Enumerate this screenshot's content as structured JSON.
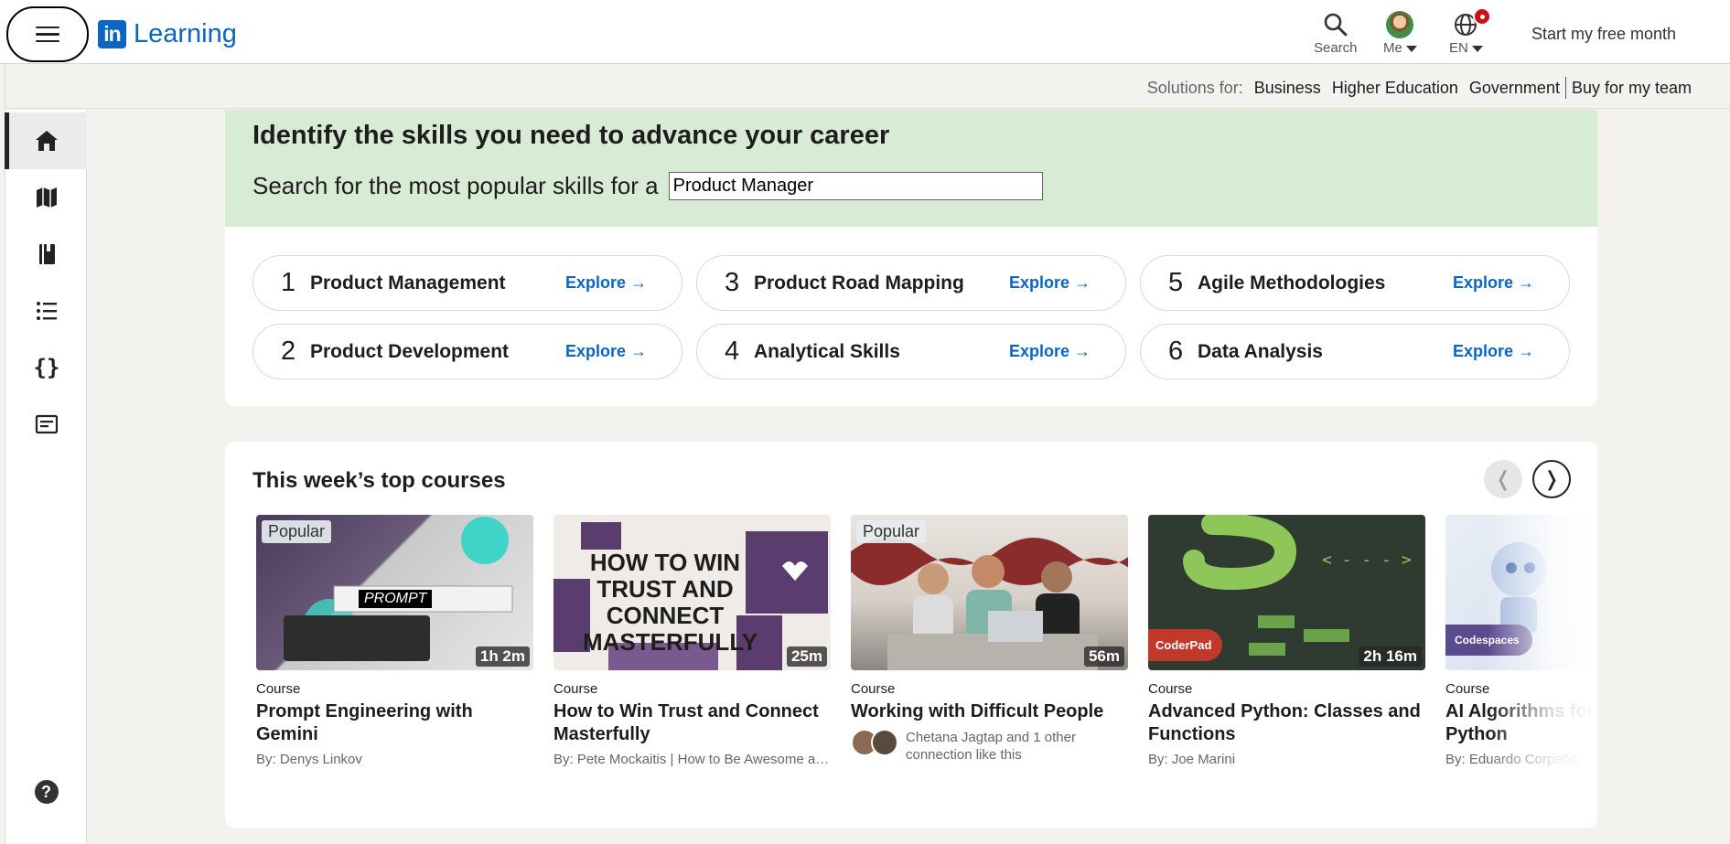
{
  "header": {
    "logo_mark": "in",
    "logo_text": "Learning",
    "search_label": "Search",
    "me_label": "Me",
    "lang_label": "EN",
    "free_month_label": "Start my free month",
    "accent_color": "#0a66c2"
  },
  "solutions": {
    "prefix": "Solutions for:",
    "links": [
      "Business",
      "Higher Education",
      "Government",
      "Buy for my team"
    ]
  },
  "rail": {
    "items": [
      "home-icon",
      "map-icon",
      "book-icon",
      "list-icon",
      "code-braces-icon",
      "certificate-icon"
    ],
    "help_glyph": "?"
  },
  "skills": {
    "title": "Identify the skills you need to advance your career",
    "subtitle": "Search for the most popular skills for a",
    "role_value": "Product Manager",
    "explore_label": "Explore →",
    "items": [
      {
        "num": "1",
        "name": "Product Management"
      },
      {
        "num": "2",
        "name": "Product Development"
      },
      {
        "num": "3",
        "name": "Product Road Mapping"
      },
      {
        "num": "4",
        "name": "Analytical Skills"
      },
      {
        "num": "5",
        "name": "Agile Methodologies"
      },
      {
        "num": "6",
        "name": "Data Analysis"
      }
    ]
  },
  "courses": {
    "title": "This week’s top courses",
    "prev_glyph": "❬",
    "next_glyph": "❭",
    "items": [
      {
        "tag": "Popular",
        "duration": "1h 2m",
        "type": "Course",
        "title": "Prompt Engineering with Gemini",
        "by": "By: Denys Linkov",
        "thumb_text": "PROMPT"
      },
      {
        "tag": "",
        "duration": "25m",
        "type": "Course",
        "title": "How to Win Trust and Connect Masterfully",
        "by": "By: Pete Mockaitis | How to Be Awesome at Your Job",
        "thumb_text": "HOW TO WIN TRUST AND CONNECT MASTERFULLY"
      },
      {
        "tag": "Popular",
        "duration": "56m",
        "type": "Course",
        "title": "Working with Difficult People",
        "by": "Chetana Jagtap and 1 other connection like this",
        "thumb_text": ""
      },
      {
        "tag": "",
        "duration": "2h 16m",
        "type": "Course",
        "title": "Advanced Python: Classes and Functions",
        "by": "By: Joe Marini",
        "thumb_text": "CoderPad"
      },
      {
        "tag": "",
        "duration": "",
        "type": "Course",
        "title": "AI Algorithms for Gaming with Python",
        "by": "By: Eduardo Corpeño",
        "thumb_text": "Codespaces"
      }
    ]
  }
}
